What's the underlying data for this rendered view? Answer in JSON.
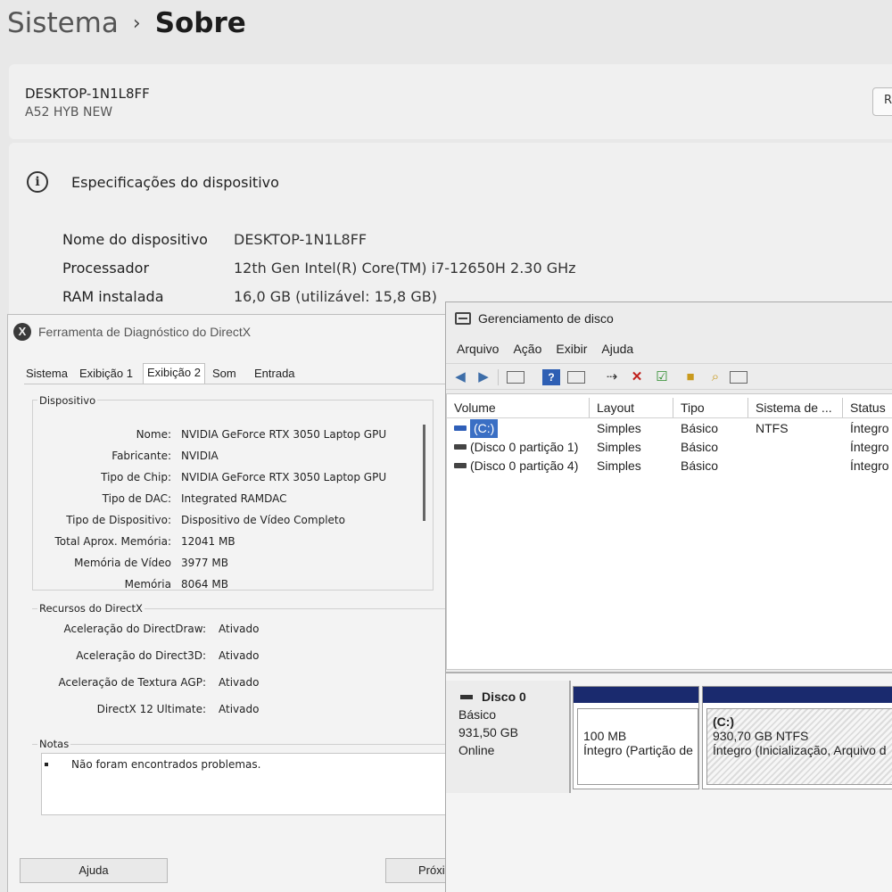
{
  "settings": {
    "breadcrumb_parent": "Sistema",
    "breadcrumb_sep": "›",
    "breadcrumb_current": "Sobre",
    "device_name": "DESKTOP-1N1L8FF",
    "device_model": "A52 HYB NEW",
    "rename_label": "R",
    "specs_title": "Especificações do dispositivo",
    "specs": [
      {
        "label": "Nome do dispositivo",
        "value": "DESKTOP-1N1L8FF"
      },
      {
        "label": "Processador",
        "value": "12th Gen Intel(R) Core(TM) i7-12650H   2.30 GHz"
      },
      {
        "label": "RAM instalada",
        "value": "16,0 GB (utilizável: 15,8 GB)"
      }
    ]
  },
  "dxdiag": {
    "title": "Ferramenta de Diagnóstico do DirectX",
    "tabs": [
      "Sistema",
      "Exibição 1",
      "Exibição 2",
      "Som",
      "Entrada"
    ],
    "active_tab": "Exibição 2",
    "device_group": "Dispositivo",
    "device": [
      {
        "key": "Nome:",
        "value": "NVIDIA GeForce RTX 3050 Laptop GPU"
      },
      {
        "key": "Fabricante:",
        "value": "NVIDIA"
      },
      {
        "key": "Tipo de Chip:",
        "value": "NVIDIA GeForce RTX 3050 Laptop GPU"
      },
      {
        "key": "Tipo de DAC:",
        "value": "Integrated RAMDAC"
      },
      {
        "key": "Tipo de Dispositivo:",
        "value": "Dispositivo de Vídeo Completo"
      },
      {
        "key": "Total Aprox. Memória:",
        "value": "12041 MB"
      },
      {
        "key": "Memória de Vídeo",
        "value": "3977 MB"
      },
      {
        "key": "Memória",
        "value": "8064 MB"
      }
    ],
    "resources_group": "Recursos do DirectX",
    "resources": [
      {
        "key": "Aceleração do DirectDraw:",
        "value": "Ativado"
      },
      {
        "key": "Aceleração do Direct3D:",
        "value": "Ativado"
      },
      {
        "key": "Aceleração de Textura AGP:",
        "value": "Ativado"
      },
      {
        "key": "DirectX 12 Ultimate:",
        "value": "Ativado"
      }
    ],
    "notes_group": "Notas",
    "notes_text": "Não foram encontrados problemas.",
    "help_button": "Ajuda",
    "next_button": "Próxi"
  },
  "diskmgmt": {
    "title": "Gerenciamento de disco",
    "menu": [
      "Arquivo",
      "Ação",
      "Exibir",
      "Ajuda"
    ],
    "toolbar_icons": [
      "back-arrow-icon",
      "forward-arrow-icon",
      "panel-icon",
      "help-icon",
      "properties-icon",
      "connect-icon",
      "delete-icon",
      "check-icon",
      "import-icon",
      "search-icon",
      "list-icon"
    ],
    "columns": [
      "Volume",
      "Layout",
      "Tipo",
      "Sistema de ...",
      "Status"
    ],
    "volumes": [
      {
        "volume": "(C:)",
        "layout": "Simples",
        "tipo": "Básico",
        "fs": "NTFS",
        "status": "Íntegro"
      },
      {
        "volume": "(Disco 0 partição 1)",
        "layout": "Simples",
        "tipo": "Básico",
        "fs": "",
        "status": "Íntegro"
      },
      {
        "volume": "(Disco 0 partição 4)",
        "layout": "Simples",
        "tipo": "Básico",
        "fs": "",
        "status": "Íntegro"
      }
    ],
    "disk": {
      "name": "Disco 0",
      "type": "Básico",
      "size": "931,50 GB",
      "state": "Online"
    },
    "partitions": [
      {
        "title": "",
        "size": "100 MB",
        "status": "Íntegro (Partição de"
      },
      {
        "title": "(C:)",
        "size": "930,70 GB NTFS",
        "status": "Íntegro (Inicialização, Arquivo d"
      }
    ]
  }
}
